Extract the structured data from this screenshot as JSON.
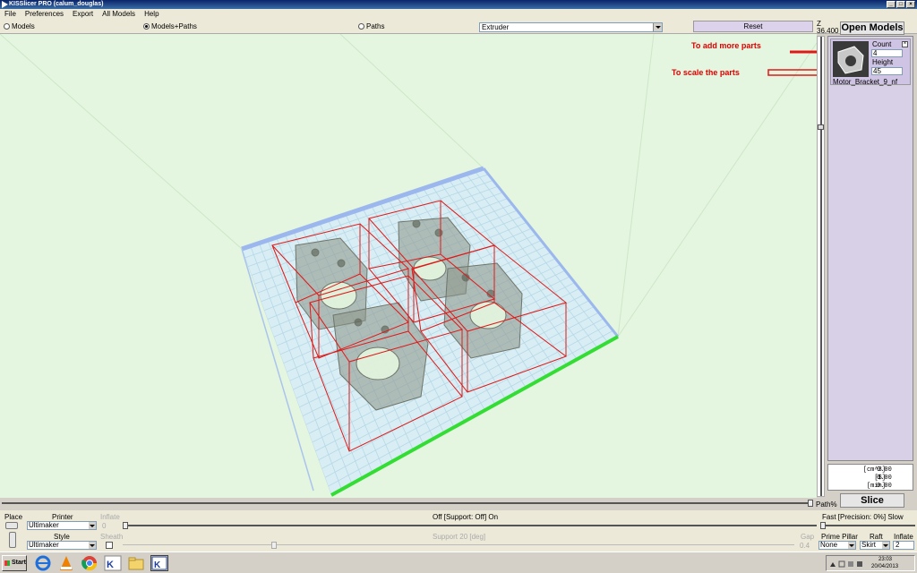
{
  "window": {
    "title": "KISSlicer PRO (calum_douglas)"
  },
  "menu": [
    "File",
    "Preferences",
    "Export",
    "All Models",
    "Help"
  ],
  "view_modes": {
    "models": "Models",
    "models_paths": "Models+Paths",
    "paths": "Paths",
    "selected": "Models+Paths"
  },
  "extruder_select": "Extruder",
  "reset_label": "Reset",
  "z_label": "Z",
  "z_value": "36.400",
  "open_models_label": "Open Models",
  "annotations": {
    "add_parts": "To add more parts",
    "scale_parts": "To scale the parts"
  },
  "model": {
    "count_label": "Count",
    "count_value": "4",
    "height_label": "Height",
    "height_value": "45",
    "name": "Motor_Bracket_9_nf"
  },
  "stats": [
    {
      "label": "[cm^3]",
      "value": "0.00"
    },
    {
      "label": "[$]",
      "value": "0.00"
    },
    {
      "label": "[min]",
      "value": "0.00"
    }
  ],
  "slice_label": "Slice",
  "path_pct_label": "Path%",
  "bottom": {
    "place_label": "Place",
    "printer_label": "Printer",
    "printer_value": "Ultimaker",
    "inflate_label": "Inflate",
    "inflate_value": "0",
    "support_text": "Off [Support: Off] On",
    "precision_text": "Fast [Precision: 0%] Slow",
    "style_label": "Style",
    "style_value": "Ultimaker",
    "sheath_label": "Sheath",
    "support_deg": "Support 20 [deg]",
    "gap_label": "Gap",
    "gap_value": "0.4",
    "prime_pillar_label": "Prime Pillar",
    "prime_pillar_value": "None",
    "raft_label": "Raft",
    "raft_value": "Skirt",
    "inflate2_label": "Inflate",
    "inflate2_value": "2"
  },
  "taskbar": {
    "start_label": "Start",
    "time": "23:03",
    "date": "20/04/2013"
  }
}
